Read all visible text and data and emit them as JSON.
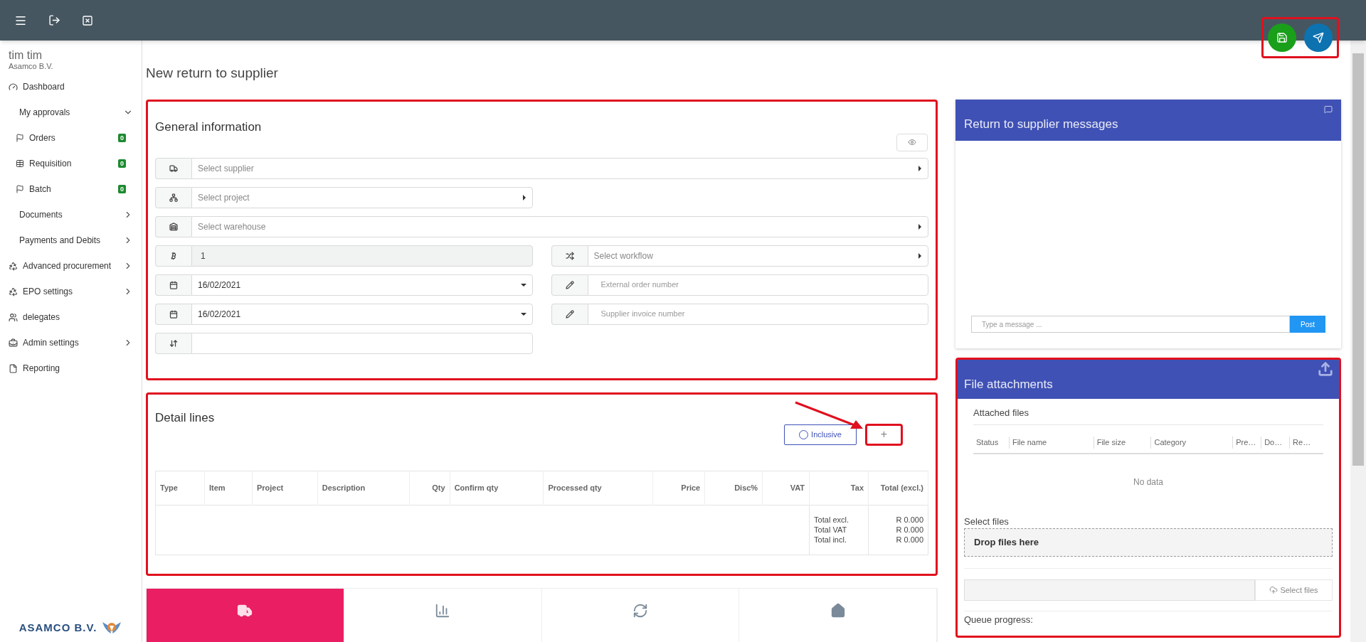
{
  "user": {
    "name": "tim tim",
    "company": "Asamco B.V."
  },
  "sidebar": {
    "items": [
      {
        "kind": "link",
        "label": "Dashboard"
      },
      {
        "kind": "group",
        "label": "My approvals",
        "expanded": true,
        "children": [
          {
            "label": "Orders",
            "badge": "0"
          },
          {
            "label": "Requisition",
            "badge": "0"
          },
          {
            "label": "Batch",
            "badge": "0"
          }
        ]
      },
      {
        "kind": "group",
        "label": "Documents",
        "expanded": false
      },
      {
        "kind": "group",
        "label": "Payments and Debits",
        "expanded": false
      },
      {
        "kind": "link",
        "label": "Advanced procurement",
        "expanded": false
      },
      {
        "kind": "link",
        "label": "EPO settings",
        "expanded": false
      },
      {
        "kind": "link",
        "label": "delegates"
      },
      {
        "kind": "link",
        "label": "Admin settings",
        "expanded": false
      },
      {
        "kind": "link",
        "label": "Reporting"
      }
    ],
    "logo": "ASAMCO B.V."
  },
  "actions": {
    "highlighted": true
  },
  "page_title": "New return to supplier",
  "general": {
    "title": "General information",
    "highlighted": true,
    "rows": [
      [
        {
          "kind": "select",
          "placeholder": "Select supplier",
          "wide": true
        }
      ],
      [
        {
          "kind": "select",
          "placeholder": "Select project",
          "wide": false
        }
      ],
      [
        {
          "kind": "select",
          "placeholder": "Select warehouse",
          "wide": true
        }
      ],
      [
        {
          "kind": "readonly",
          "value": "1"
        },
        {
          "kind": "select",
          "placeholder": "Select workflow"
        }
      ],
      [
        {
          "kind": "date",
          "value": "16/02/2021"
        },
        {
          "kind": "input",
          "placeholder": "External order number"
        }
      ],
      [
        {
          "kind": "date",
          "value": "16/02/2021"
        },
        {
          "kind": "input",
          "placeholder": "Supplier invoice number"
        }
      ],
      [
        {
          "kind": "input"
        }
      ]
    ]
  },
  "detail_lines": {
    "title": "Detail lines",
    "highlighted": true,
    "inclusive": {
      "label": "Inclusive",
      "checked": false
    },
    "add_button": {
      "label": "+",
      "highlighted": true,
      "pointed_at": true
    },
    "columns": [
      {
        "label": "Type",
        "numeric": false
      },
      {
        "label": "Item",
        "numeric": false
      },
      {
        "label": "Project",
        "numeric": false
      },
      {
        "label": "Description",
        "numeric": false
      },
      {
        "label": "Qty",
        "numeric": true
      },
      {
        "label": "Confirm qty",
        "numeric": false
      },
      {
        "label": "Processed qty",
        "numeric": false
      },
      {
        "label": "Price",
        "numeric": true
      },
      {
        "label": "Disc%",
        "numeric": true
      },
      {
        "label": "VAT",
        "numeric": true
      },
      {
        "label": "Tax",
        "numeric": true
      },
      {
        "label": "Total (excl.)",
        "numeric": true
      }
    ],
    "totals": [
      {
        "label": "Total excl.",
        "value": "R 0.000"
      },
      {
        "label": "Total VAT",
        "value": "R 0.000"
      },
      {
        "label": "Total incl.",
        "value": "R 0.000"
      }
    ]
  },
  "tiles": [
    {
      "selected": true
    },
    {
      "selected": false
    },
    {
      "selected": false
    },
    {
      "selected": false
    }
  ],
  "messages": {
    "title": "Return to supplier messages",
    "placeholder": "Type a message ...",
    "post": "Post"
  },
  "files": {
    "title": "File attachments",
    "highlighted": true,
    "attached_title": "Attached files",
    "columns": [
      "Status",
      "File name",
      "File size",
      "Category",
      "Pre…",
      "Do…",
      "Re…"
    ],
    "empty": "No data",
    "select_label": "Select files",
    "drop": "Drop files here",
    "select_button": "Select files",
    "queue": "Queue progress:"
  }
}
